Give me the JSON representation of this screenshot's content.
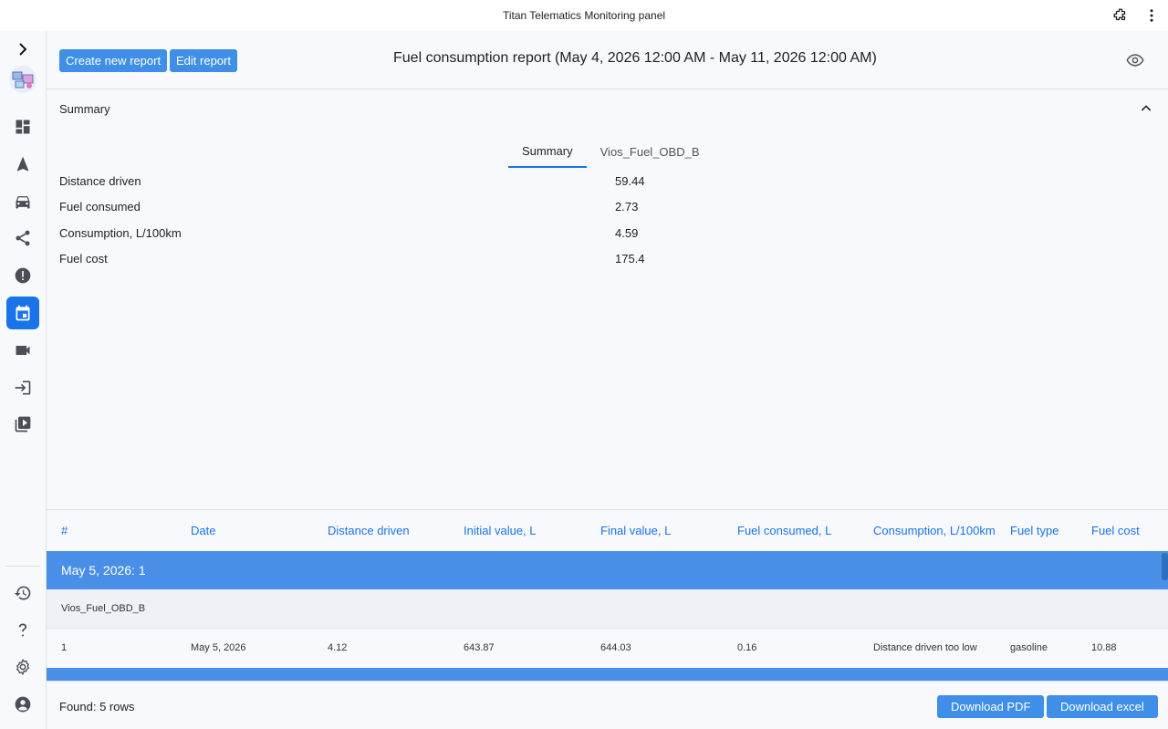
{
  "app": {
    "title": "Titan Telematics Monitoring panel"
  },
  "sidebar": {
    "items": [
      {
        "icon": "chevron-right-icon"
      },
      {
        "icon": "logo-icon"
      },
      {
        "icon": "dashboard-icon"
      },
      {
        "icon": "navigation-icon"
      },
      {
        "icon": "car-icon"
      },
      {
        "icon": "share-icon"
      },
      {
        "icon": "alert-icon"
      },
      {
        "icon": "calendar-icon",
        "active": true
      },
      {
        "icon": "video-camera-icon"
      },
      {
        "icon": "login-icon"
      },
      {
        "icon": "video-library-icon"
      },
      {
        "icon": "history-icon"
      },
      {
        "icon": "help-icon"
      },
      {
        "icon": "settings-icon"
      },
      {
        "icon": "account-icon"
      }
    ]
  },
  "toolbar": {
    "create_label": "Create new report",
    "edit_label": "Edit report",
    "report_title": "Fuel consumption report (May 4, 2026 12:00 AM - May 11, 2026 12:00 AM)"
  },
  "summary": {
    "section_label": "Summary",
    "tabs": [
      {
        "label": "Summary",
        "active": true
      },
      {
        "label": "Vios_Fuel_OBD_B",
        "active": false
      }
    ],
    "rows": [
      {
        "label": "Distance driven",
        "value": "59.44"
      },
      {
        "label": "Fuel consumed",
        "value": "2.73"
      },
      {
        "label": "Consumption, L/100km",
        "value": "4.59"
      },
      {
        "label": "Fuel cost",
        "value": "175.4"
      }
    ]
  },
  "table": {
    "columns": [
      "#",
      "Date",
      "Distance driven",
      "Initial value, L",
      "Final value, L",
      "Fuel consumed, L",
      "Consumption, L/100km",
      "Fuel type",
      "Fuel cost"
    ],
    "group_label": "May 5, 2026: 1",
    "sub_label": "Vios_Fuel_OBD_B",
    "rows": [
      [
        "1",
        "May 5, 2026",
        "4.12",
        "643.87",
        "644.03",
        "0.16",
        "Distance driven too low",
        "gasoline",
        "10.88"
      ]
    ]
  },
  "footer": {
    "found_text": "Found: 5 rows",
    "download_pdf": "Download PDF",
    "download_excel": "Download excel"
  },
  "colors": {
    "accent": "#1a73e8",
    "button": "#3f8fe8",
    "group_row": "#4a8fe7"
  }
}
